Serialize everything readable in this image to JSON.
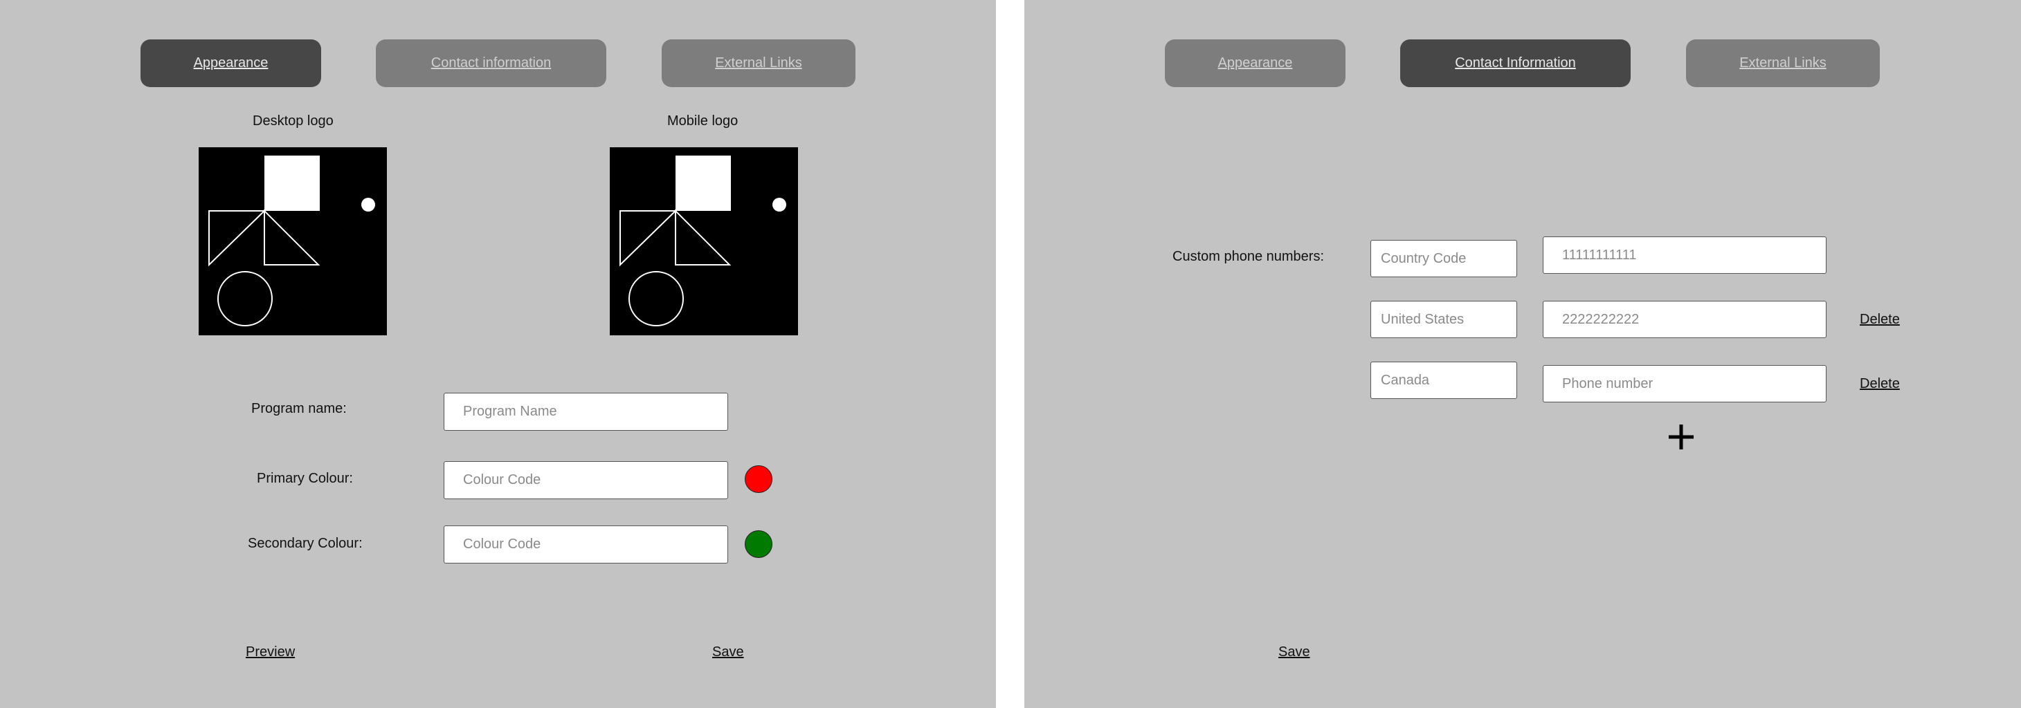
{
  "appearance_screen": {
    "tabs": [
      {
        "label": "Appearance",
        "active": true
      },
      {
        "label": "Contact information",
        "active": false
      },
      {
        "label": "External Links",
        "active": false
      }
    ],
    "desktop_logo_label": "Desktop logo",
    "mobile_logo_label": "Mobile logo",
    "program_name": {
      "label": "Program name:",
      "placeholder": "Program Name"
    },
    "primary_colour": {
      "label": "Primary Colour:",
      "placeholder": "Colour Code",
      "swatch": "#ff0000"
    },
    "secondary_colour": {
      "label": "Secondary Colour:",
      "placeholder": "Colour Code",
      "swatch": "#007a00"
    },
    "preview_label": "Preview",
    "save_label": "Save"
  },
  "contact_screen": {
    "tabs": [
      {
        "label": "Appearance",
        "active": false
      },
      {
        "label": "Contact Information",
        "active": true
      },
      {
        "label": "External Links",
        "active": false
      }
    ],
    "custom_phone_label": "Custom phone numbers:",
    "rows": [
      {
        "country": "Country Code",
        "phone": "11111111111",
        "delete_label": ""
      },
      {
        "country": "United States",
        "phone": "2222222222",
        "delete_label": "Delete"
      },
      {
        "country": "Canada",
        "phone": "Phone number",
        "delete_label": "Delete"
      }
    ],
    "add_icon": "plus-icon",
    "save_label": "Save"
  },
  "colors": {
    "panel_bg": "#c3c3c3",
    "active_tab": "#474747",
    "inactive_tab": "#7d7d7d",
    "divider": "#ffffff"
  }
}
